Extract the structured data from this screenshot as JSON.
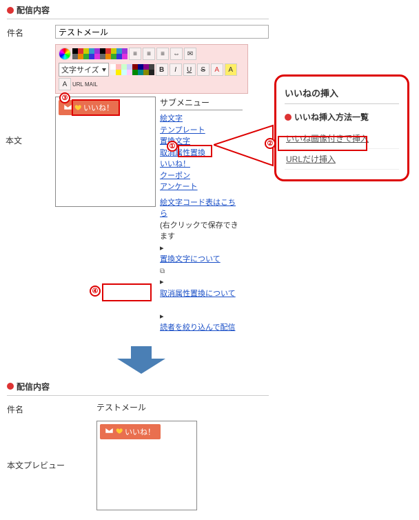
{
  "sections": {
    "edit_title": "配信内容",
    "preview_title": "配信内容"
  },
  "labels": {
    "subject": "件名",
    "body": "本文",
    "body_preview": "本文プレビュー"
  },
  "subject_value": "テストメール",
  "toolbar": {
    "fontsize_label": "文字サイズ",
    "bold": "B",
    "italic": "I",
    "underline": "U",
    "strike": "S",
    "a1": "A",
    "a2": "A",
    "a3": "A",
    "url": "URL",
    "mail": "MAIL"
  },
  "like_button": "いいね！",
  "submenu": {
    "title": "サブメニュー",
    "items": [
      "絵文字",
      "テンプレート",
      "置換文字",
      "取消属性置換",
      "いいね！",
      "クーポン",
      "アンケート"
    ]
  },
  "notes": {
    "emoji_chart": "絵文字コード表はこちら",
    "right_click": "(右クリックで保存できます",
    "link_replace": "置換文字について",
    "link_cancel": "取消属性置換について",
    "link_filter": "読者を絞り込んで配信"
  },
  "preview_subject": "テストメール",
  "popup": {
    "title": "いいねの挿入",
    "sub": "いいね挿入方法一覧",
    "opt_image": "いいね画像付きで挿入",
    "opt_url": "URLだけ挿入"
  },
  "markers": {
    "m1": "①",
    "m2": "②",
    "m3": "③",
    "m4": "④"
  },
  "palette_main": [
    "#000",
    "#666",
    "#d33",
    "#e80",
    "#cc0",
    "#3a3",
    "#39c",
    "#33d",
    "#93d",
    "#d3d"
  ],
  "palette_ext": [
    "#fff",
    "#eee",
    "#fbb",
    "#fe0",
    "#cfc",
    "#cff",
    "#ccf",
    "#fcf",
    "#800",
    "#080",
    "#008",
    "#088",
    "#808",
    "#880",
    "#444",
    "#222"
  ]
}
